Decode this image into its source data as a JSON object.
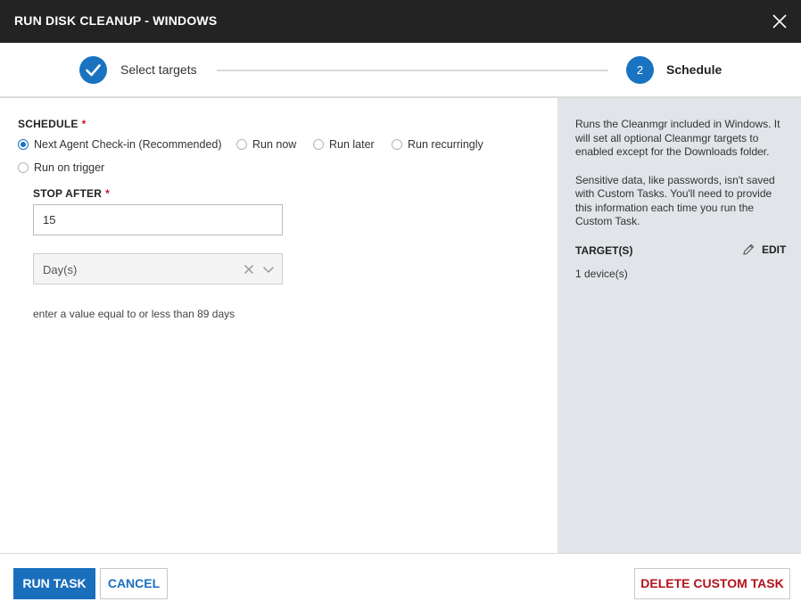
{
  "title": "RUN DISK CLEANUP - WINDOWS",
  "close_icon": "close-icon",
  "steps": [
    {
      "number": "1",
      "label": "Select targets",
      "state": "complete",
      "icon": "checkmark-icon"
    },
    {
      "number": "2",
      "label": "Schedule",
      "state": "active"
    }
  ],
  "colors": {
    "accent": "#1a73c1",
    "titlebar": "#232323",
    "required": "#c8102e",
    "danger": "#b5121b",
    "side_panel": "#e1e4e8"
  },
  "schedule": {
    "label": "SCHEDULE",
    "required_mark": "*",
    "options": [
      {
        "label": "Next Agent Check-in (Recommended)",
        "selected": true
      },
      {
        "label": "Run now",
        "selected": false
      },
      {
        "label": "Run later",
        "selected": false
      },
      {
        "label": "Run recurringly",
        "selected": false
      },
      {
        "label": "Run on trigger",
        "selected": false
      }
    ]
  },
  "stop_after": {
    "label": "STOP AFTER",
    "required_mark": "*",
    "value": "15",
    "unit_value": "Day(s)",
    "hint": "enter a value equal to or less than 89 days"
  },
  "side": {
    "description": [
      "Runs the Cleanmgr included in Windows. It will set all optional Cleanmgr targets to enabled except for the Downloads folder.",
      "Sensitive data, like passwords, isn't saved with Custom Tasks. You'll need to provide this information each time you run the Custom Task."
    ],
    "targets_title": "TARGET(S)",
    "edit_label": "EDIT",
    "edit_icon": "pencil-icon",
    "targets_count": "1 device(s)"
  },
  "footer": {
    "run_label": "RUN TASK",
    "cancel_label": "CANCEL",
    "delete_label": "DELETE CUSTOM TASK"
  }
}
